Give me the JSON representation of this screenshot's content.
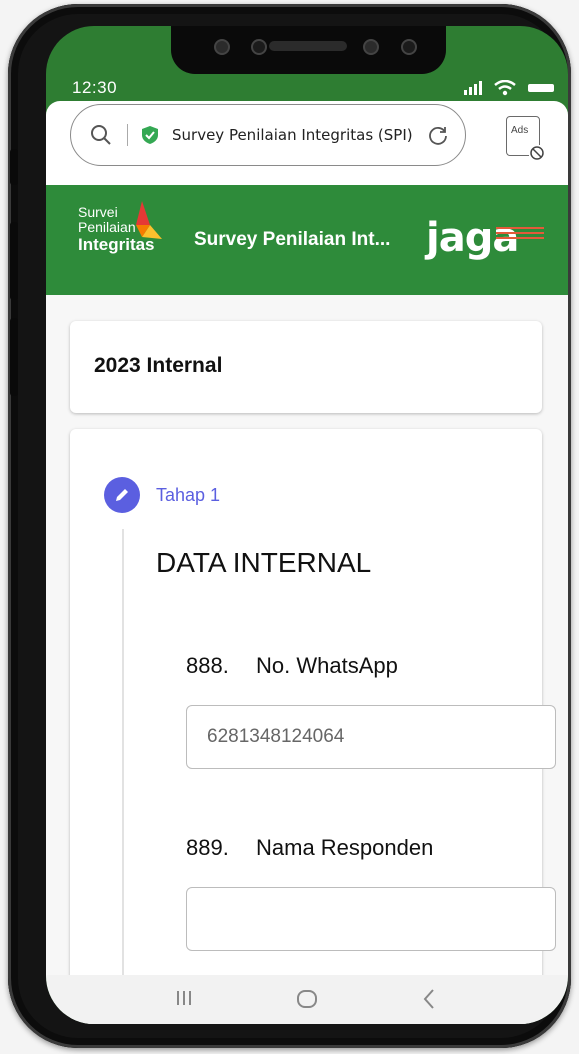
{
  "status_bar": {
    "time": "12:30"
  },
  "browser": {
    "url_text": "Survey Penilaian Integritas (SPI)",
    "ads_label": "Ads"
  },
  "header": {
    "logo_line1": "Survei",
    "logo_line2": "Penilaian",
    "logo_line3": "Integritas",
    "title": "Survey Penilaian Int...",
    "jaga_logo": "jaga"
  },
  "card": {
    "title": "2023 Internal"
  },
  "stepper": {
    "step_label": "Tahap 1",
    "section_title": "DATA INTERNAL"
  },
  "questions": [
    {
      "number": "888.",
      "label": "No. WhatsApp",
      "value": "6281348124064"
    },
    {
      "number": "889.",
      "label": "Nama Responden",
      "value": ""
    }
  ],
  "colors": {
    "header_green": "#2e8b3a",
    "step_accent": "#5b5fe0",
    "secure_green": "#34a853"
  },
  "icons": {
    "search": "search-icon",
    "secure": "shield-check-icon",
    "reload": "reload-icon",
    "ads_block": "ads-block-icon",
    "edit": "pencil-icon",
    "nav_recent": "recent-apps-icon",
    "nav_home": "home-icon",
    "nav_back": "back-icon"
  }
}
